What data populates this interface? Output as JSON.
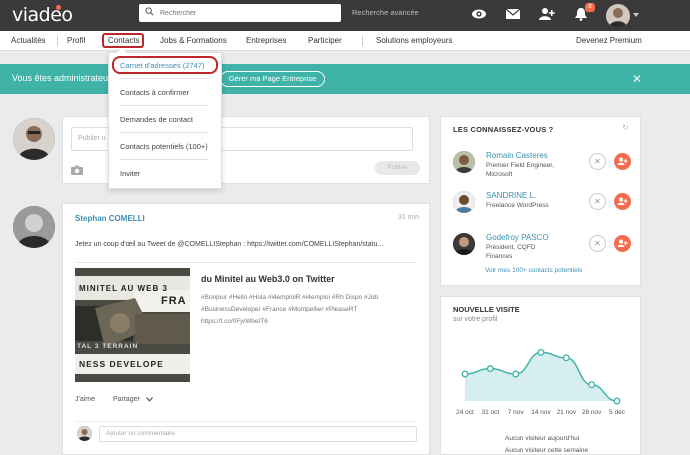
{
  "brand": {
    "logo": "viadeo"
  },
  "search": {
    "placeholder": "Rechercher",
    "advanced": "Recherche avancée"
  },
  "header": {
    "notifications_count": "8"
  },
  "nav": {
    "items": [
      "Actualités",
      "Profil",
      "Contacts",
      "Jobs & Formations",
      "Entreprises",
      "Participer",
      "Solutions employeurs"
    ],
    "premium": "Devenez Premium"
  },
  "contacts_menu": {
    "items": [
      "Carnet d'adresses (2747)",
      "Contacts à confirmer",
      "Demandes de contact",
      "Contacts potentiels (100+)",
      "Inviter"
    ]
  },
  "banner": {
    "text": "Vous êtes administrateur",
    "button": "Gérer ma Page Entreprise"
  },
  "composer": {
    "placeholder": "Publier u",
    "publish": "Publier"
  },
  "post": {
    "author": "Stephan COMELLI",
    "time": "31 min",
    "text": "Jetez un coup d'œil au Tweet de @COMELLIStephan : https://twitter.com/COMELLIStephan/statu...",
    "link_title": "du Minitel au Web3.0 on Twitter",
    "link_desc": "#Bonjour #Hello #Hola #i4emploiR #i4emploi #Rh Dispo #Job #BusinessDeveloper #France #Montpellier #PleaseRT https://t.co/0FjvWbeIT6",
    "thumb_texts": [
      "MINITEL AU WEB 3",
      "FRA",
      "TAL 3 TERRAIN",
      "NESS DEVELOPE"
    ],
    "like": "J'aime",
    "share": "Partager",
    "comment_placeholder": "Ajouter un commentaire"
  },
  "suggestions": {
    "title": "LES CONNAISSEZ-VOUS ?",
    "people": [
      {
        "name": "Romain Casteres",
        "line1": "Premier Field Engineer,",
        "line2": "Microsoft"
      },
      {
        "name": "SANDRINE L.",
        "line1": "Freelance WordPress",
        "line2": ""
      },
      {
        "name": "Godefroy PASCO",
        "line1": "Président, CQFD",
        "line2": "Finances"
      }
    ],
    "see_all": "Voir mes 100+ contacts potentiels"
  },
  "visits": {
    "title": "NOUVELLE VISITE",
    "subtitle": "sur votre profil",
    "stat_today": "Aucun visiteur aujourd'hui",
    "stat_week": "Aucun visiteur cette semaine"
  },
  "chart_data": {
    "type": "area",
    "categories": [
      "24 oct",
      "31 oct",
      "7 nov",
      "14 nov",
      "21 nov",
      "28 nov",
      "5 déc"
    ],
    "values": [
      5,
      6,
      5,
      9,
      8,
      3,
      0
    ],
    "ylim": [
      0,
      10
    ],
    "color": "#40b3a9",
    "fill": "#d6eef0"
  }
}
